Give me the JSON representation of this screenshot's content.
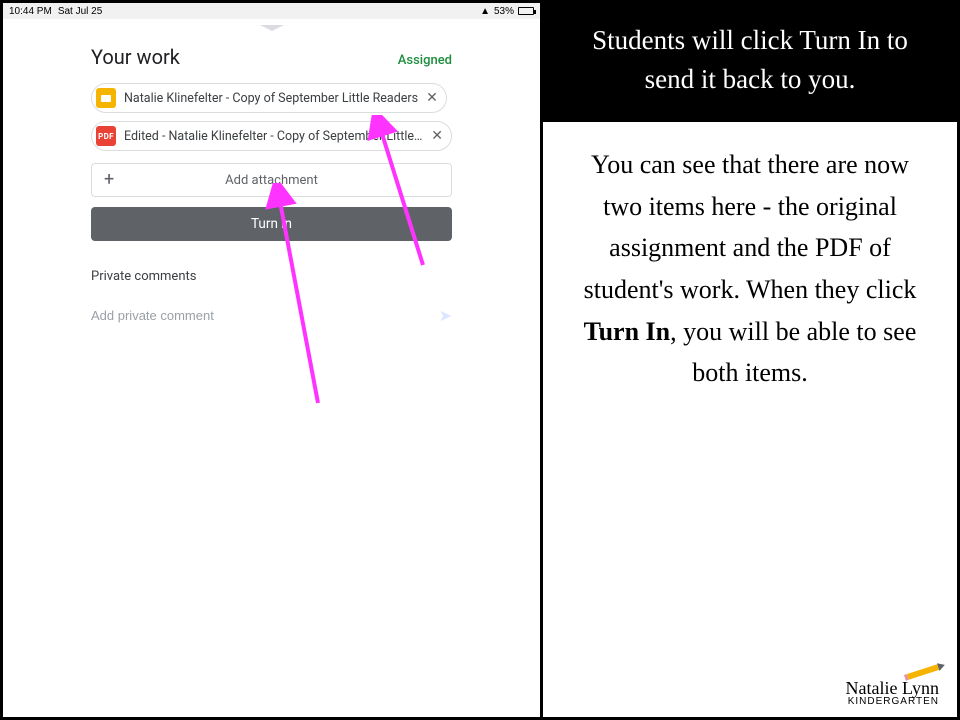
{
  "status_bar": {
    "time": "10:44 PM",
    "date": "Sat Jul 25",
    "battery_pct": "53%",
    "battery_fill_pct": 53
  },
  "work": {
    "title": "Your work",
    "status": "Assigned",
    "attachments": [
      {
        "type": "slides",
        "label": "Natalie Klinefelter - Copy of September Little Readers"
      },
      {
        "type": "pdf",
        "pdf_badge": "PDF",
        "label": "Edited - Natalie Klinefelter - Copy of September Little Readers.pdf"
      }
    ],
    "add_attachment_label": "Add attachment",
    "turn_in_label": "Turn in",
    "private_comments_label": "Private comments",
    "private_comment_placeholder": "Add private comment"
  },
  "instruction": {
    "header": "Students will click Turn In to send it back to you.",
    "body_before": "You can see that there are now two items here - the original assignment and the PDF of student's work. When they click ",
    "body_bold": "Turn In",
    "body_after": ", you will be able to see both items."
  },
  "logo": {
    "name": "Natalie Lynn",
    "sub": "KINDERGARTEN"
  }
}
